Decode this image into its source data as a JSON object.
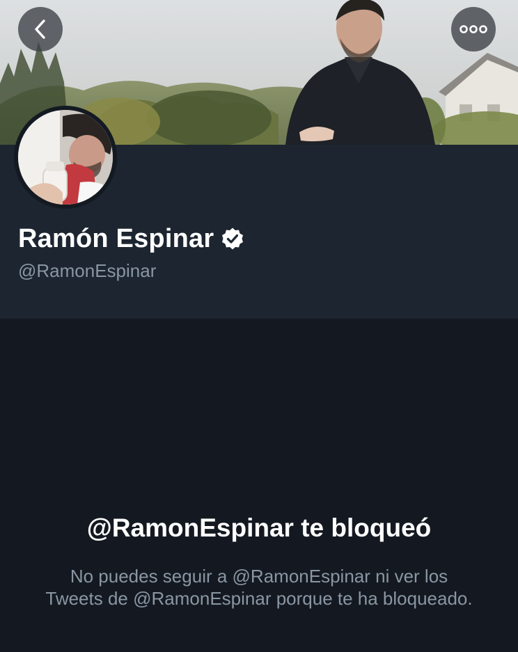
{
  "nav": {
    "back_icon": "chevron-left-icon",
    "more_icon": "more-horizontal-icon"
  },
  "profile": {
    "name": "Ramón Espinar",
    "handle": "@RamonEspinar",
    "verified": true
  },
  "blocked": {
    "title": "@RamonEspinar te bloqueó",
    "message": "No puedes seguir a @RamonEspinar ni ver los Tweets de @RamonEspinar porque te ha bloqueado."
  },
  "colors": {
    "background": "#141921",
    "header_background": "#1c2530",
    "primary_text": "#ffffff",
    "secondary_text": "#8a96a3",
    "button_background": "#3c4046"
  }
}
